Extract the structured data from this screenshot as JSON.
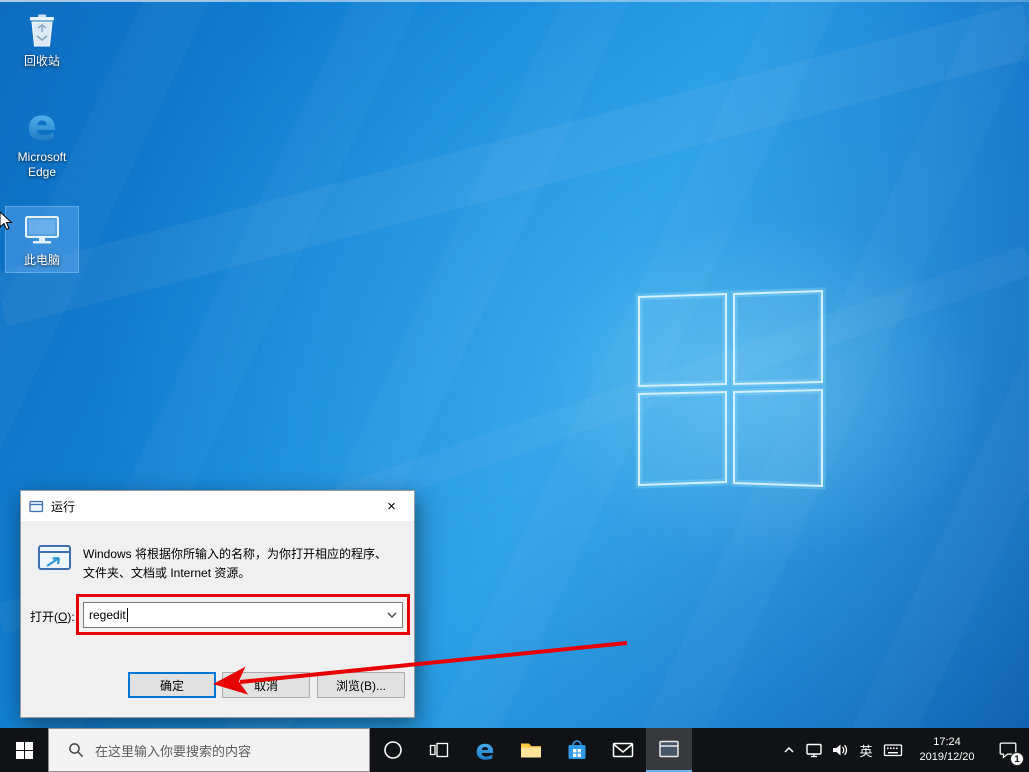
{
  "colors": {
    "accent": "#0078d7",
    "annotation_red": "#e60000",
    "taskbar_bg": "#101216"
  },
  "desktop": {
    "icons": {
      "recycle_bin_label": "回收站",
      "edge_label": "Microsoft Edge",
      "this_pc_label": "此电脑"
    }
  },
  "run_dialog": {
    "title": "运行",
    "close_glyph": "×",
    "description": "Windows 将根据你所输入的名称，为你打开相应的程序、文件夹、文档或 Internet 资源。",
    "open_label_pre": "打开(",
    "open_label_key": "O",
    "open_label_post": "):",
    "input_value": "regedit",
    "buttons": {
      "ok": "确定",
      "cancel": "取消",
      "browse": "浏览(B)..."
    }
  },
  "taskbar": {
    "search_placeholder": "在这里输入你要搜索的内容",
    "edge_glyph": "e",
    "tray": {
      "ime": "英",
      "time": "17:24",
      "date": "2019/12/20",
      "notification_badge": "1"
    }
  }
}
